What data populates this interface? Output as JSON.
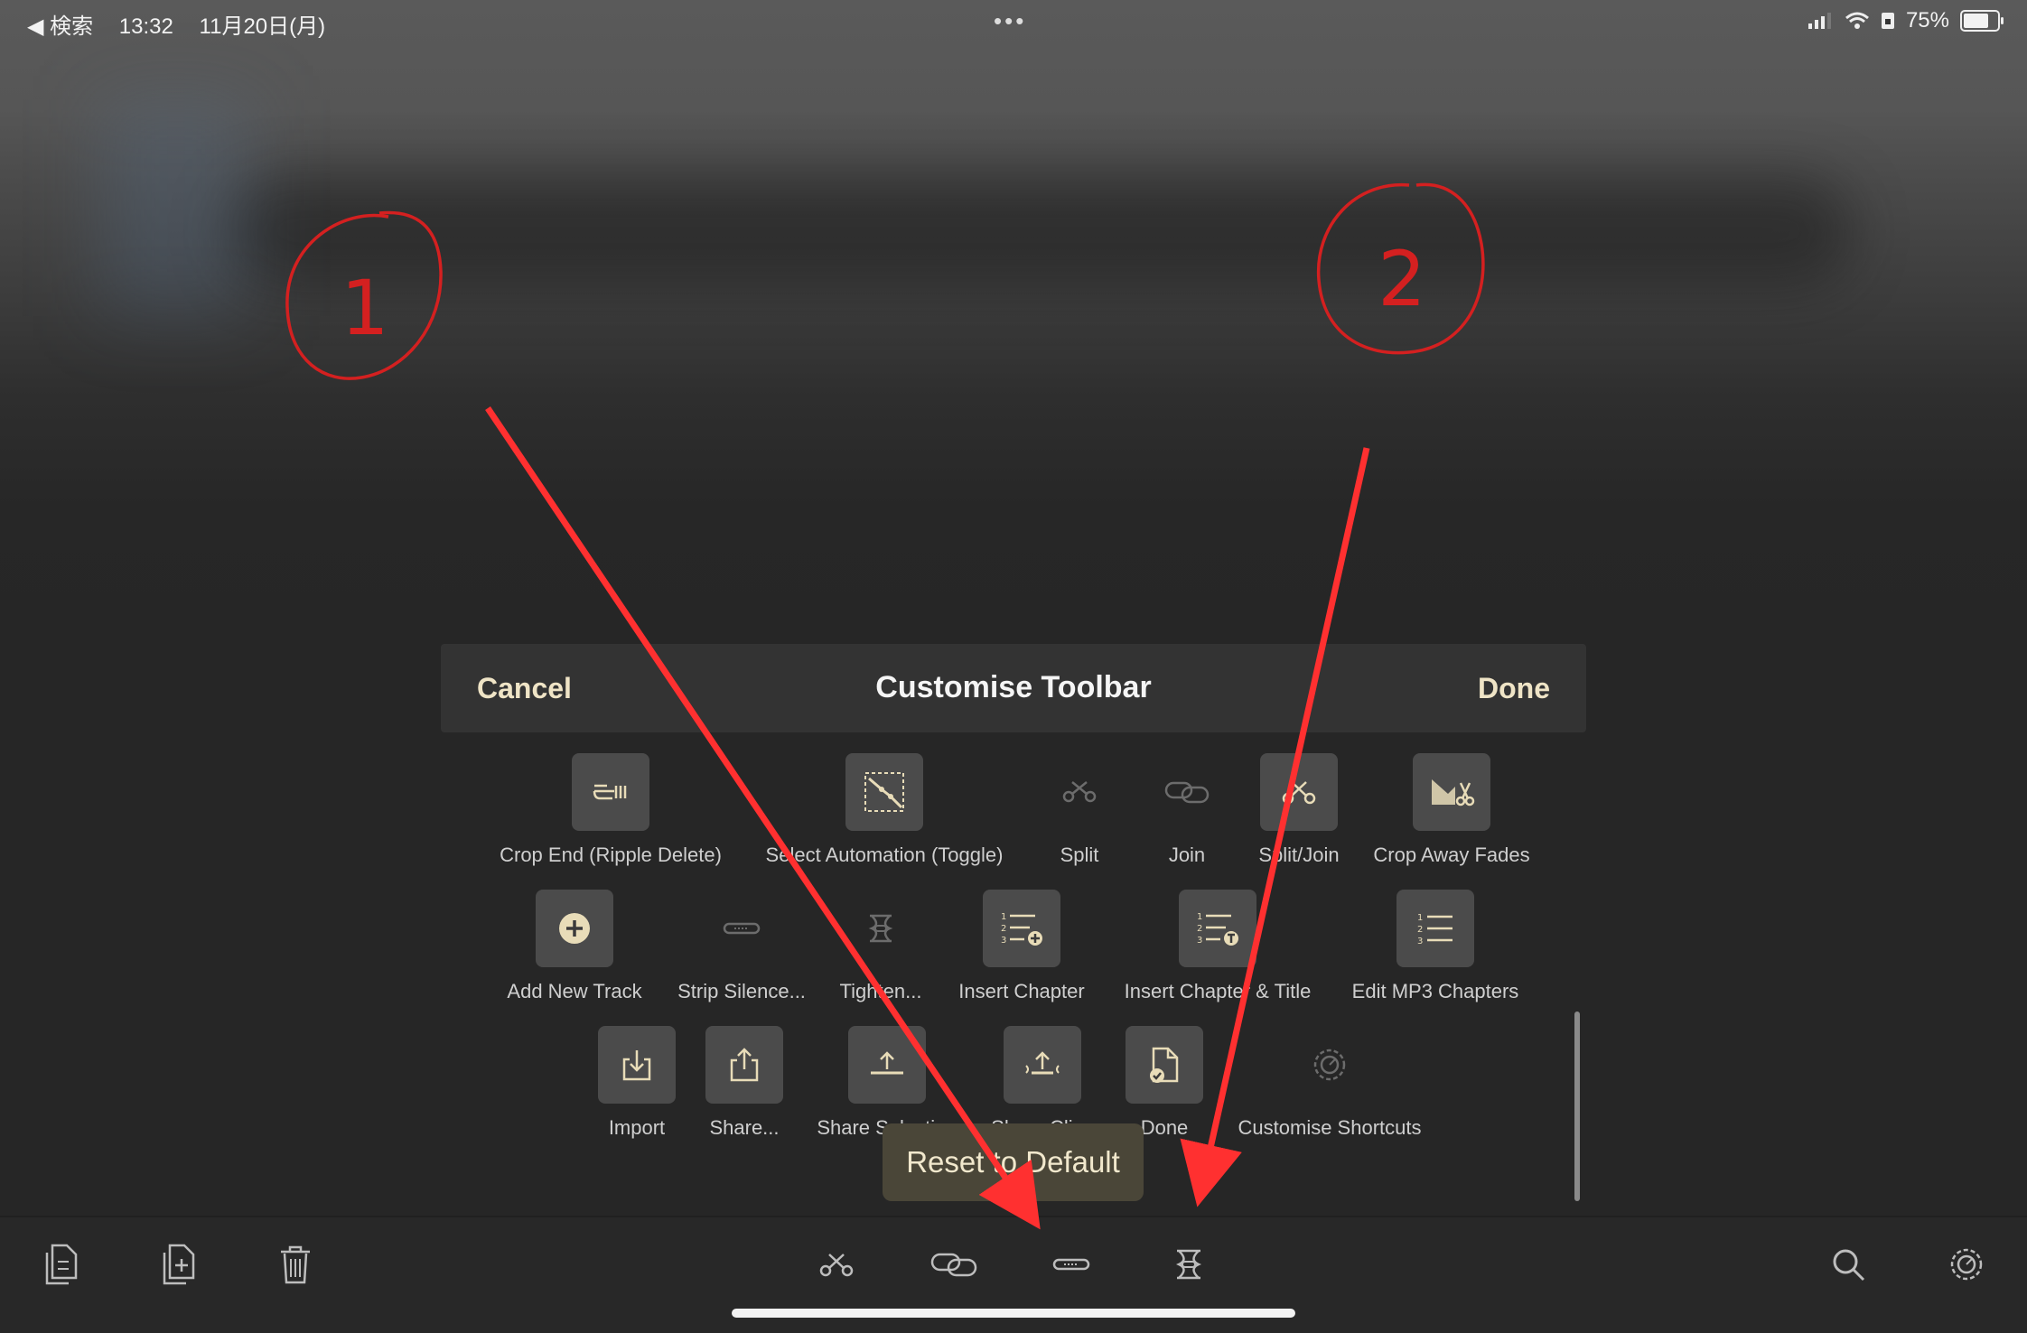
{
  "status_bar": {
    "back_label": "◀ 検索",
    "time": "13:32",
    "date": "11月20日(月)",
    "more": "•••",
    "battery_text": "75%",
    "battery_level": 0.75
  },
  "panel": {
    "cancel_label": "Cancel",
    "title": "Customise Toolbar",
    "done_label": "Done",
    "reset_label": "Reset to Default"
  },
  "tools": [
    {
      "label": "Crop End (Ripple Delete)",
      "icon": "crop-end-icon",
      "boxed": true
    },
    {
      "label": "Select Automation (Toggle)",
      "icon": "select-automation-icon",
      "boxed": true
    },
    {
      "label": "Split",
      "icon": "split-scissors-icon",
      "boxed": false
    },
    {
      "label": "Join",
      "icon": "join-link-icon",
      "boxed": false
    },
    {
      "label": "Split/Join",
      "icon": "split-join-icon",
      "boxed": true
    },
    {
      "label": "Crop Away Fades",
      "icon": "crop-fades-icon",
      "boxed": true
    },
    {
      "label": "Add New Track",
      "icon": "add-track-icon",
      "boxed": true
    },
    {
      "label": "Strip Silence...",
      "icon": "strip-silence-icon",
      "boxed": false
    },
    {
      "label": "Tighten...",
      "icon": "tighten-icon",
      "boxed": false
    },
    {
      "label": "Insert Chapter",
      "icon": "insert-chapter-icon",
      "boxed": true
    },
    {
      "label": "Insert Chapter & Title",
      "icon": "insert-chapter-title-icon",
      "boxed": true
    },
    {
      "label": "Edit MP3 Chapters",
      "icon": "edit-chapters-icon",
      "boxed": true
    },
    {
      "label": "Import",
      "icon": "import-icon",
      "boxed": true
    },
    {
      "label": "Share...",
      "icon": "share-icon",
      "boxed": true
    },
    {
      "label": "Share Selection",
      "icon": "share-selection-icon",
      "boxed": true
    },
    {
      "label": "Share Clips",
      "icon": "share-clips-icon",
      "boxed": true
    },
    {
      "label": "Done",
      "icon": "done-document-icon",
      "boxed": true
    },
    {
      "label": "Customise Shortcuts",
      "icon": "customise-shortcuts-icon",
      "boxed": false
    }
  ],
  "bottom_toolbar": [
    {
      "name": "copy-button",
      "icon": "copy-document-icon"
    },
    {
      "name": "paste-button",
      "icon": "paste-document-icon"
    },
    {
      "name": "delete-button",
      "icon": "trash-icon"
    },
    {
      "name": "split-button",
      "icon": "split-scissors-icon"
    },
    {
      "name": "join-button",
      "icon": "join-link-icon"
    },
    {
      "name": "strip-silence-button",
      "icon": "strip-silence-icon"
    },
    {
      "name": "tighten-button",
      "icon": "tighten-icon"
    },
    {
      "name": "search-button",
      "icon": "search-icon"
    },
    {
      "name": "settings-button",
      "icon": "gear-icon"
    }
  ],
  "annotations": [
    {
      "label": "1"
    },
    {
      "label": "2"
    }
  ]
}
